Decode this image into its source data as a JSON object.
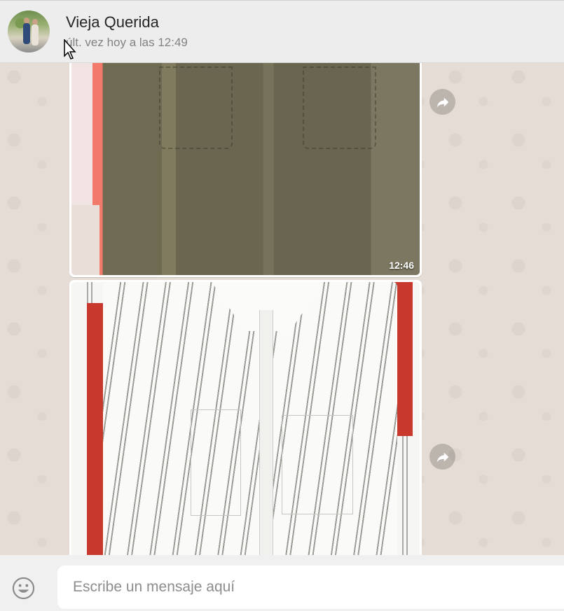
{
  "header": {
    "contact_name": "Vieja Querida",
    "last_seen": "últ. vez hoy a las 12:49"
  },
  "messages": [
    {
      "type": "image",
      "timestamp": "12:46",
      "description_icon": "forward-icon"
    },
    {
      "type": "image",
      "timestamp": "",
      "description_icon": "forward-icon"
    }
  ],
  "composer": {
    "placeholder": "Escribe un mensaje aquí",
    "emoji_icon": "smiley-icon"
  },
  "colors": {
    "header_bg": "#ededed",
    "chat_bg": "#e5ddd5",
    "footer_bg": "#f0f0f0"
  }
}
